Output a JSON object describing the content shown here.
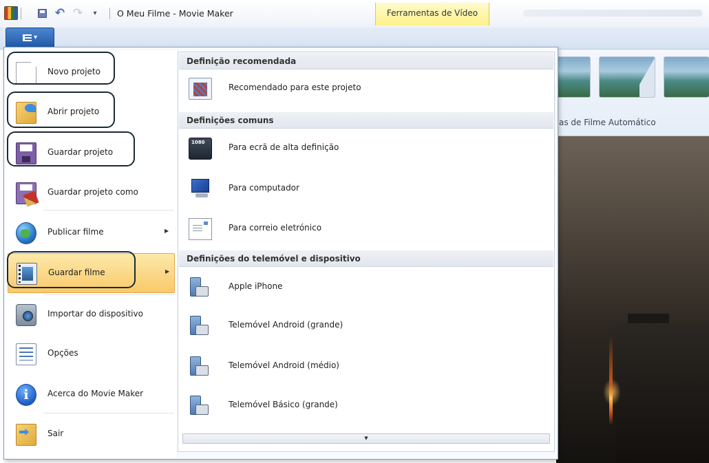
{
  "window": {
    "title": "O Meu Filme - Movie Maker",
    "context_tab": "Ferramentas de Vídeo",
    "quick_access": [
      "save-icon",
      "undo-icon",
      "redo-icon",
      "customize-icon"
    ]
  },
  "ribbon": {
    "app_button_icon": "app-menu-icon",
    "background_label": "as de Filme Automático"
  },
  "menu": {
    "items": [
      {
        "label": "Novo projeto",
        "icon": "new-document-icon",
        "has_submenu": false
      },
      {
        "label": "Abrir projeto",
        "icon": "open-folder-icon",
        "has_submenu": false
      },
      {
        "label": "Guardar projeto",
        "icon": "save-disk-icon",
        "has_submenu": false
      },
      {
        "label": "Guardar projeto como",
        "icon": "save-as-icon",
        "has_submenu": false
      },
      {
        "label": "Publicar filme",
        "icon": "globe-icon",
        "has_submenu": true
      },
      {
        "label": "Guardar filme",
        "icon": "film-icon",
        "has_submenu": true,
        "highlighted": true
      },
      {
        "label": "Importar do dispositivo",
        "icon": "camera-icon",
        "has_submenu": false
      },
      {
        "label": "Opções",
        "icon": "options-icon",
        "has_submenu": false
      },
      {
        "label": "Acerca do Movie Maker",
        "icon": "info-icon",
        "has_submenu": false
      },
      {
        "label": "Sair",
        "icon": "exit-icon",
        "has_submenu": false
      }
    ],
    "submenu_arrow": "▶"
  },
  "submenu": {
    "sections": [
      {
        "header": "Definição recomendada",
        "items": [
          {
            "label": "Recomendado para este projeto",
            "icon": "recommended-icon"
          }
        ]
      },
      {
        "header": "Definições comuns",
        "items": [
          {
            "label": "Para ecrã de alta definição",
            "icon": "hd-display-icon"
          },
          {
            "label": "Para computador",
            "icon": "computer-icon"
          },
          {
            "label": "Para correio eletrónico",
            "icon": "email-icon"
          }
        ]
      },
      {
        "header": "Definições do telemóvel e dispositivo",
        "items": [
          {
            "label": "Apple iPhone",
            "icon": "phone-icon"
          },
          {
            "label": "Telemóvel Android (grande)",
            "icon": "phone-icon"
          },
          {
            "label": "Telemóvel Android (médio)",
            "icon": "phone-icon"
          },
          {
            "label": "Telemóvel Básico (grande)",
            "icon": "phone-icon"
          }
        ]
      }
    ],
    "scroll_glyph": "▼"
  },
  "colors": {
    "highlight": "#f9c96a",
    "app_button": "#225aa8",
    "context_tab": "#fff18a",
    "callout_border": "#1a2a33"
  }
}
